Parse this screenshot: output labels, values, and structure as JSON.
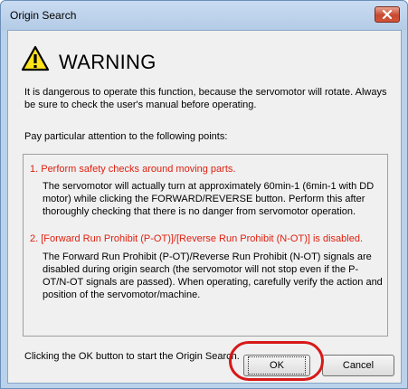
{
  "window": {
    "title": "Origin Search",
    "close_icon": "close-icon",
    "title_bar_color": "#c9dcf2"
  },
  "warning": {
    "icon": "warning-triangle-icon",
    "heading": "WARNING",
    "intro": "It is dangerous to operate this function, because the servomotor will rotate. Always be sure to check the user's manual before operating.",
    "points_heading": "Pay particular attention to the following points:"
  },
  "points": [
    {
      "title": "1. Perform safety checks around moving parts.",
      "body": "The servomotor will actually turn at approximately 60min-1 (6min-1 with DD motor) while clicking the FORWARD/REVERSE button. Perform this after thoroughly checking that there is no danger from servomotor operation."
    },
    {
      "title": "2. [Forward Run Prohibit (P-OT)]/[Reverse Run Prohibit (N-OT)] is disabled.",
      "body": "The Forward Run Prohibit (P-OT)/Reverse Run Prohibit (N-OT) signals are disabled during origin search (the servomotor will not stop even if the P-OT/N-OT signals are passed). When operating, carefully verify the action and position of the servomotor/machine."
    }
  ],
  "footer": {
    "instruction": "Clicking the OK button to start the Origin Search.",
    "ok_label": "OK",
    "cancel_label": "Cancel"
  },
  "colors": {
    "point_title": "#e02010",
    "highlight": "#d81818",
    "warning_fill": "#ffe21c"
  }
}
